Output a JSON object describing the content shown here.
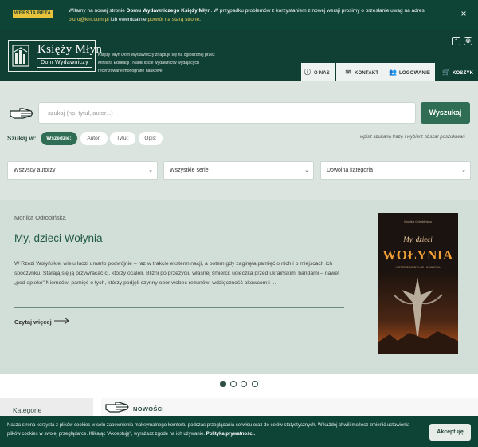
{
  "beta_bar": {
    "badge": "WERSJA BETA",
    "text_1": "Witamy na nowej stronie ",
    "text_bold": "Domu Wydawniczego Księży Młyn",
    "text_2": ". W przypadku problemów z korzystaniem z nowej wersji prosimy o przesłanie uwag na adres ",
    "email": "biuro@km.com.pl",
    "text_3": " lub ewentualnie ",
    "old_link": "powrót na starą stronę",
    "text_4": ".",
    "close": "×"
  },
  "header": {
    "logo_title": "Księży Młyn",
    "logo_subtitle": "Dom Wydawniczy",
    "description": "Księży Młyn Dom Wydawniczy znajduje się na ogłoszonej przez Ministra Edukacji i Nauki liście wydawnictw wydających recenzowane monografie naukowe.",
    "social": {
      "facebook": "f",
      "instagram": "◎"
    },
    "nav": [
      {
        "label": "O NAS",
        "icon": "info-icon"
      },
      {
        "label": "KONTAKT",
        "icon": "envelope-icon"
      },
      {
        "label": "LOGOWANIE",
        "icon": "users-icon"
      },
      {
        "label": "KOSZYK",
        "icon": "cart-icon"
      }
    ]
  },
  "search": {
    "placeholder": "szukaj (np. tytuł, autor...)",
    "button": "Wyszukaj",
    "scope_label": "Szukaj w:",
    "scopes": [
      "Wszedzie:",
      "Autor:",
      "Tytuł:",
      "Opis:"
    ],
    "active_scope": "Wszedzie:",
    "hint": "wpisz szukaną frazę i wybierz obszar poszukiwań",
    "filters": [
      "Wszyscy autorzy",
      "Wszystkie serie",
      "Dowolna kategoria"
    ]
  },
  "hero": {
    "author": "Monika Odrobińska",
    "title": "My, dzieci Wołynia",
    "description": "W Rzezi Wołyńskiej wielu ludzi umarło podwójnie – raz w trakcie eksterminacji, a potem gdy zaginęła pamięć o nich i o miejscach ich spoczynku. Starają się ją przywracać ci, którzy ocaleli. Bliźni po przeżyciu własnej śmierci: ucieczka przed ukraińskimi bandami – nawet „pod opiekę” Niemców; pamięć o tych, którzy podjęli czynny opór wobec rezunów; wdzięczność akowcom i ...",
    "read_more": "Czytaj więcej",
    "cover": {
      "author": "Monika Odrobińska",
      "line1": "My, dzieci",
      "line2": "WOŁYNIA",
      "subtitle": "HISTORIE NIEBYŁYCH OCALENIA"
    },
    "slides_total": 4,
    "slide_active": 1
  },
  "sidebar": {
    "heading": "Kategorie"
  },
  "section": {
    "heading": "NOWOŚCI"
  },
  "cookies": {
    "text_1": "Nasza strona korzysta z plików cookies w celu zapewnienia maksymalnego komfortu podczas przeglądania serwisu oraz do celów statystycznych. W każdej chwili możesz zmienić ustawienia plików cookies w swojej przeglądarce. Klikając \"Akceptuję\", wyrażasz zgodę na ich używanie. ",
    "policy": "Polityka prywatności.",
    "accept": "Akceptuję"
  }
}
